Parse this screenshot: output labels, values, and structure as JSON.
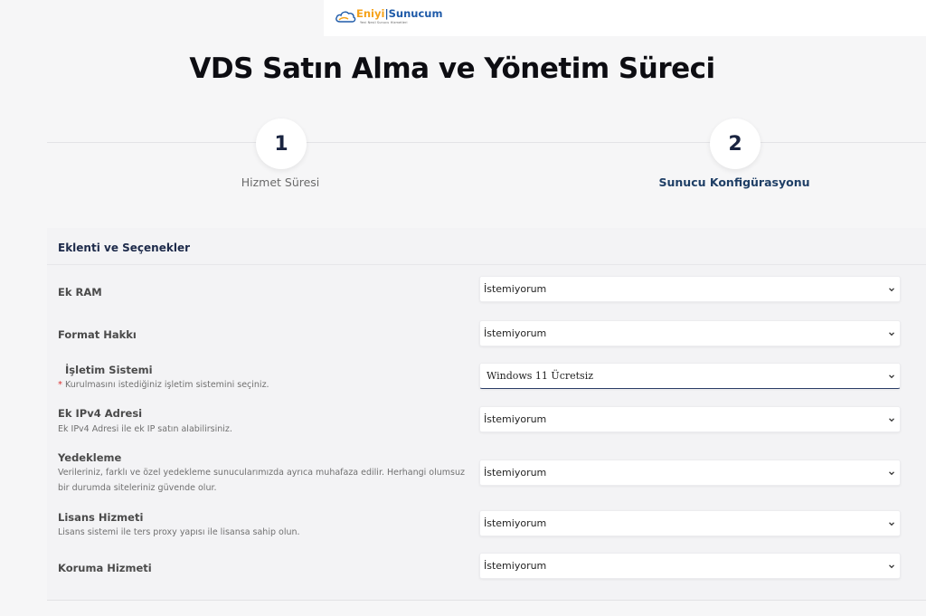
{
  "brand": {
    "name_part1": "Eniyi",
    "name_part2": "Sunucum",
    "tagline": "Yeni Nesil Sunucu Hizmetleri"
  },
  "page": {
    "title": "VDS Satın Alma ve Yönetim Süreci"
  },
  "steps": [
    {
      "number": "1",
      "label": "Hizmet Süresi",
      "active": false
    },
    {
      "number": "2",
      "label": "Sunucu Konfigürasyonu",
      "active": true
    }
  ],
  "addons": {
    "section_title": "Eklenti ve Seçenekler",
    "rows": [
      {
        "label": "Ek RAM",
        "description": "",
        "value": "İstemiyorum"
      },
      {
        "label": "Format Hakkı",
        "description": "",
        "value": "İstemiyorum"
      },
      {
        "label": "İşletim Sistemi",
        "description": "Kurulmasını istediğiniz işletim sistemini seçiniz.",
        "required": true,
        "value": "Windows 11 Ücretsiz"
      },
      {
        "label": "Ek IPv4 Adresi",
        "description": "Ek IPv4 Adresi ile ek IP satın alabilirsiniz.",
        "value": "İstemiyorum"
      },
      {
        "label": "Yedekleme",
        "description": "Verileriniz, farklı ve özel yedekleme sunucularımızda ayrıca muhafaza edilir. Herhangi olumsuz bir durumda siteleriniz güvende olur.",
        "value": "İstemiyorum"
      },
      {
        "label": "Lisans Hizmeti",
        "description": "Lisans sistemi ile ters proxy yapısı ile lisansa sahip olun.",
        "value": "İstemiyorum"
      },
      {
        "label": "Koruma Hizmeti",
        "description": "",
        "value": "İstemiyorum"
      }
    ]
  },
  "colors": {
    "brand_orange": "#f5a21a",
    "brand_blue": "#1e5aa8",
    "active_step": "#1f3f66",
    "required_star": "#dd3333"
  },
  "icons": {
    "select_arrow": "chevron-down-icon",
    "logo": "cloud-logo-icon"
  }
}
